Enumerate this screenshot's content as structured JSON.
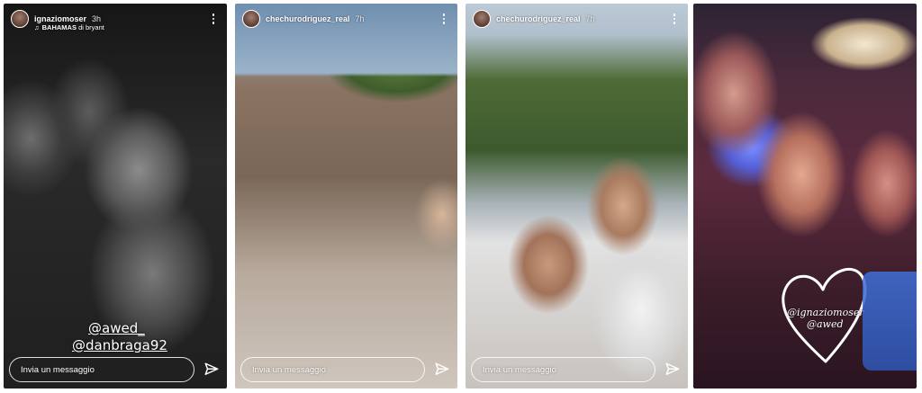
{
  "stories": [
    {
      "username": "ignaziomoser",
      "time": "3h",
      "music_title": "BAHAMAS",
      "music_connector": "di",
      "music_artist": "bryant",
      "mentions": [
        "@awed_",
        "@danbraga92"
      ],
      "message_placeholder": "Invia un messaggio"
    },
    {
      "username": "chechurodriguez_real",
      "time": "7h",
      "message_placeholder": "Invia un messaggio"
    },
    {
      "username": "chechurodriguez_real",
      "time": "7h",
      "message_placeholder": "Invia un messaggio"
    },
    {
      "sticker_lines": [
        "@ignaziomoser",
        "@awed"
      ]
    }
  ],
  "icons": {
    "more": "more-vertical-icon",
    "send": "send-icon",
    "music": "music-note-icon",
    "sticker": "heart-drawing-icon"
  }
}
